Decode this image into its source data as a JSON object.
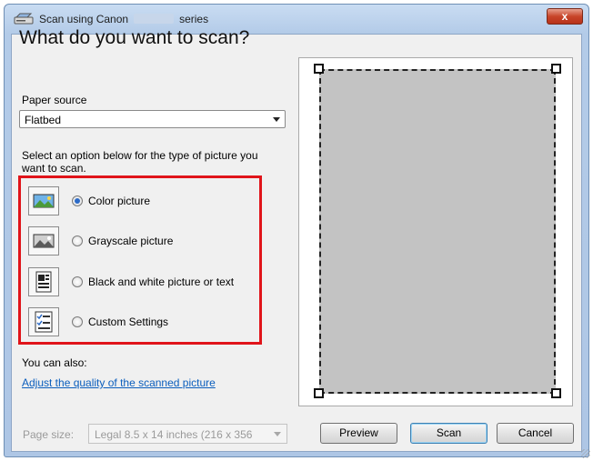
{
  "window": {
    "title_prefix": "Scan using Canon",
    "title_suffix": "series",
    "close_label": "x"
  },
  "main": {
    "heading": "What do you want to scan?",
    "paper_source_label": "Paper source",
    "paper_source_value": "Flatbed",
    "instructions_line1": "Select an option below for the type of picture you",
    "instructions_line2": "want to scan.",
    "options": [
      {
        "label": "Color picture",
        "icon": "color-photo-icon",
        "selected": true
      },
      {
        "label": "Grayscale picture",
        "icon": "grayscale-photo-icon",
        "selected": false
      },
      {
        "label": "Black and white picture or text",
        "icon": "bw-document-icon",
        "selected": false
      },
      {
        "label": "Custom Settings",
        "icon": "custom-settings-icon",
        "selected": false
      }
    ],
    "also_label": "You can also:",
    "quality_link": "Adjust the quality of the scanned picture",
    "page_size_label": "Page size:",
    "page_size_value": "Legal 8.5 x 14 inches (216 x 356"
  },
  "buttons": {
    "preview": "Preview",
    "scan": "Scan",
    "cancel": "Cancel"
  },
  "colors": {
    "highlight_border": "#e0141a",
    "link": "#0b5ebd",
    "preview_area": "#c3c3c3"
  }
}
